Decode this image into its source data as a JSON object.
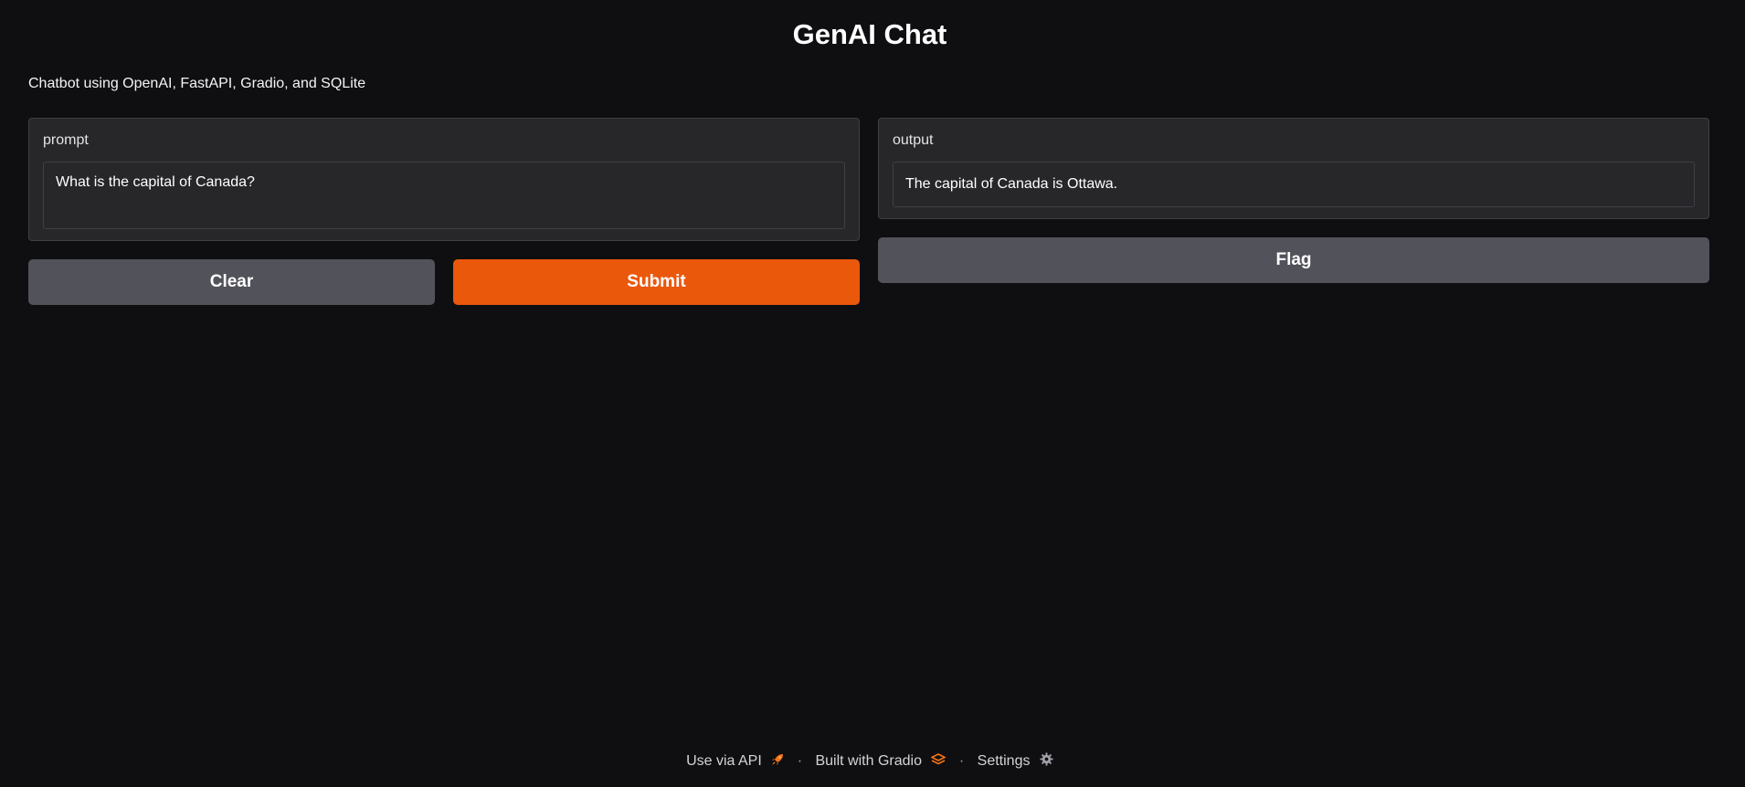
{
  "header": {
    "title": "GenAI Chat",
    "description": "Chatbot using OpenAI, FastAPI, Gradio, and SQLite"
  },
  "input_panel": {
    "label": "prompt",
    "value": "What is the capital of Canada?"
  },
  "output_panel": {
    "label": "output",
    "value": "The capital of Canada is Ottawa."
  },
  "buttons": {
    "clear_label": "Clear",
    "submit_label": "Submit",
    "flag_label": "Flag"
  },
  "footer": {
    "api_label": "Use via API",
    "api_icon": "rocket-icon",
    "built_label": "Built with Gradio",
    "gradio_icon": "gradio-logo-icon",
    "settings_label": "Settings",
    "settings_icon": "gear-icon",
    "separator": "·"
  },
  "colors": {
    "background": "#0f0f11",
    "panel": "#27272a",
    "primary": "#ea580c",
    "secondary": "#52525b"
  }
}
